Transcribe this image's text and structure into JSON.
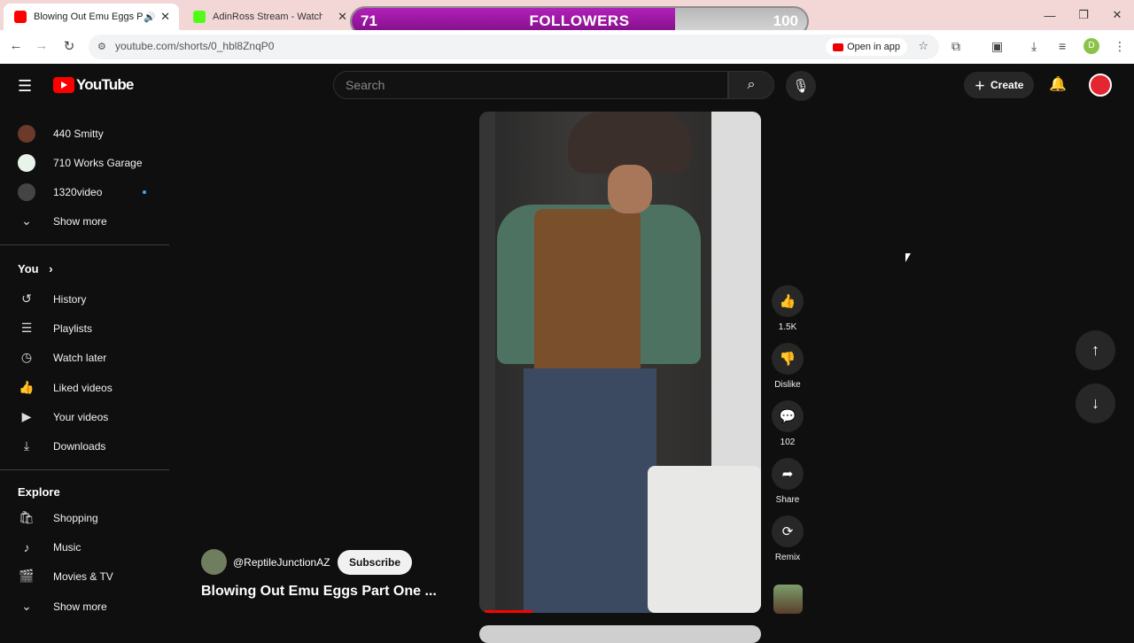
{
  "browser": {
    "tabs": [
      {
        "title": "Blowing Out Emu Eggs Part One - YouTube",
        "active": true,
        "favicon_color": "#ff0000"
      },
      {
        "title": "AdinRoss Stream - Watch Live on Kick",
        "active": false,
        "favicon_color": "#53fc18"
      }
    ],
    "url": "youtube.com/shorts/0_hbl8ZnqP0",
    "open_in_app": "Open in app",
    "profile_initial": "D"
  },
  "overlay": {
    "followers_current": "71",
    "followers_label": "FOLLOWERS",
    "followers_goal": "100",
    "progress_fraction": 0.71
  },
  "header": {
    "logo_text": "YouTube",
    "search_placeholder": "Search",
    "create_label": "Create"
  },
  "sidebar": {
    "subscriptions": [
      {
        "label": "440 Smitty",
        "color": "#6b3a2a"
      },
      {
        "label": "710 Works Garage",
        "color": "#e8f4ea"
      },
      {
        "label": "1320video",
        "color": "#444444",
        "new": true
      }
    ],
    "show_more_1": "Show more",
    "you_label": "You",
    "you_items": [
      "History",
      "Playlists",
      "Watch later",
      "Liked videos",
      "Your videos",
      "Downloads"
    ],
    "explore_label": "Explore",
    "explore_items": [
      "Shopping",
      "Music",
      "Movies & TV"
    ],
    "show_more_2": "Show more"
  },
  "short": {
    "channel_handle": "@ReptileJunctionAZ",
    "subscribe_label": "Subscribe",
    "title": "Blowing Out Emu Eggs Part One ...",
    "like_count": "1.5K",
    "dislike_label": "Dislike",
    "comment_count": "102",
    "share_label": "Share",
    "remix_label": "Remix",
    "progress_fraction": 0.17
  }
}
